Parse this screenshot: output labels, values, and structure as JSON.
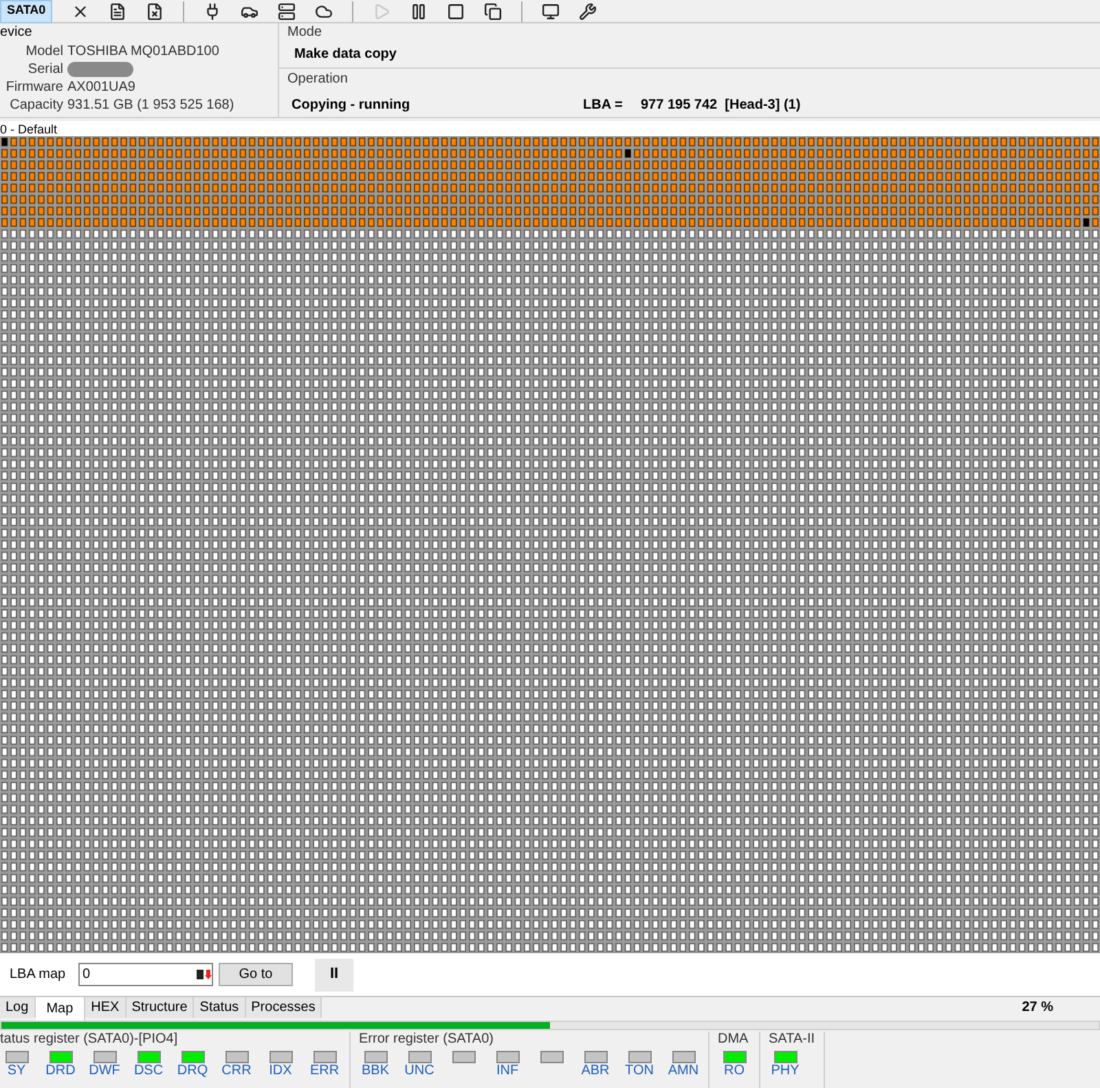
{
  "toolbar": {
    "port": {
      "label": "SATA0",
      "selected": true
    },
    "buttons": [
      {
        "kind": "x"
      },
      {
        "kind": "doc"
      },
      {
        "kind": "docx"
      },
      {
        "kind": "sep"
      },
      {
        "kind": "plug"
      },
      {
        "kind": "car"
      },
      {
        "kind": "server"
      },
      {
        "kind": "cloud"
      },
      {
        "kind": "sep"
      },
      {
        "kind": "play",
        "disabled": true
      },
      {
        "kind": "pause",
        "disabled": false
      },
      {
        "kind": "stop",
        "disabled": false
      },
      {
        "kind": "copy",
        "disabled": false
      },
      {
        "kind": "sep"
      },
      {
        "kind": "monitor"
      },
      {
        "kind": "wrench"
      }
    ]
  },
  "device": {
    "title": "evice",
    "fields": [
      {
        "label": "Model",
        "value": "TOSHIBA MQ01ABD100"
      },
      {
        "label": "Serial",
        "redacted": true
      },
      {
        "label": "Firmware",
        "value": "AX001UA9"
      },
      {
        "label": "Capacity",
        "value": "931.51 GB (1 953 525 168)"
      }
    ]
  },
  "mode": {
    "title": "Mode",
    "value": "Make data copy"
  },
  "operation": {
    "title": "Operation",
    "value": "Copying - running",
    "lba_label": "LBA =",
    "lba_value": "977 195 742  [Head-3] (1)"
  },
  "map": {
    "title": "0 - Default"
  },
  "lba_map": {
    "label": "LBA map",
    "value": "0",
    "goto": "Go to",
    "pause": "II"
  },
  "tabs": [
    {
      "label": "Log",
      "selected": false
    },
    {
      "label": "Map",
      "selected": true
    },
    {
      "label": "HEX",
      "selected": false
    },
    {
      "label": "Structure",
      "selected": false
    },
    {
      "label": "Status",
      "selected": false
    },
    {
      "label": "Processes",
      "selected": false
    }
  ],
  "progress": {
    "percent": "27 %",
    "level": 0.5
  },
  "registers": [
    {
      "title": "tatus register (SATA0)-[PIO4]",
      "leds": [
        {
          "label": "SY",
          "on": false
        },
        {
          "label": "DRD",
          "on": true
        },
        {
          "label": "DWF",
          "on": false
        },
        {
          "label": "DSC",
          "on": true
        },
        {
          "label": "DRQ",
          "on": true
        },
        {
          "label": "CRR",
          "on": false
        },
        {
          "label": "IDX",
          "on": false
        },
        {
          "label": "ERR",
          "on": false
        }
      ]
    },
    {
      "title": "Error register (SATA0)",
      "leds": [
        {
          "label": "BBK",
          "on": false
        },
        {
          "label": "UNC",
          "on": false
        },
        {
          "on": false
        },
        {
          "label": "INF",
          "on": false
        },
        {
          "on": false
        },
        {
          "label": "ABR",
          "on": false
        },
        {
          "label": "TON",
          "on": false
        },
        {
          "label": "AMN",
          "on": false
        }
      ]
    },
    {
      "title": "DMA",
      "leds": [
        {
          "label": "RO",
          "on": true
        }
      ]
    },
    {
      "title": "SATA-II",
      "leds": [
        {
          "label": "PHY",
          "on": true
        }
      ]
    }
  ]
}
